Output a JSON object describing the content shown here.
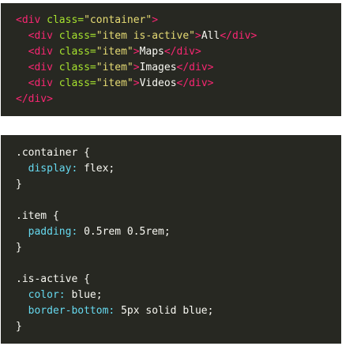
{
  "html_code": {
    "lines": [
      [
        {
          "t": "<div ",
          "c": "tag"
        },
        {
          "t": "class=",
          "c": "attr"
        },
        {
          "t": "\"container\"",
          "c": "str"
        },
        {
          "t": ">",
          "c": "tag"
        }
      ],
      [
        {
          "t": "  <div ",
          "c": "tag"
        },
        {
          "t": "class=",
          "c": "attr"
        },
        {
          "t": "\"item is-active\"",
          "c": "str"
        },
        {
          "t": ">",
          "c": "tag"
        },
        {
          "t": "All",
          "c": "text"
        },
        {
          "t": "</div>",
          "c": "tag"
        }
      ],
      [
        {
          "t": "  <div ",
          "c": "tag"
        },
        {
          "t": "class=",
          "c": "attr"
        },
        {
          "t": "\"item\"",
          "c": "str"
        },
        {
          "t": ">",
          "c": "tag"
        },
        {
          "t": "Maps",
          "c": "text"
        },
        {
          "t": "</div>",
          "c": "tag"
        }
      ],
      [
        {
          "t": "  <div ",
          "c": "tag"
        },
        {
          "t": "class=",
          "c": "attr"
        },
        {
          "t": "\"item\"",
          "c": "str"
        },
        {
          "t": ">",
          "c": "tag"
        },
        {
          "t": "Images",
          "c": "text"
        },
        {
          "t": "</div>",
          "c": "tag"
        }
      ],
      [
        {
          "t": "  <div ",
          "c": "tag"
        },
        {
          "t": "class=",
          "c": "attr"
        },
        {
          "t": "\"item\"",
          "c": "str"
        },
        {
          "t": ">",
          "c": "tag"
        },
        {
          "t": "Videos",
          "c": "text"
        },
        {
          "t": "</div>",
          "c": "tag"
        }
      ],
      [
        {
          "t": "</div>",
          "c": "tag"
        }
      ]
    ]
  },
  "css_code": {
    "lines": [
      [
        {
          "t": ".container {",
          "c": "sel"
        }
      ],
      [
        {
          "t": "  display: ",
          "c": "prop"
        },
        {
          "t": "flex;",
          "c": "text"
        }
      ],
      [
        {
          "t": "}",
          "c": "sel"
        }
      ],
      [],
      [
        {
          "t": ".item {",
          "c": "sel"
        }
      ],
      [
        {
          "t": "  padding: ",
          "c": "prop"
        },
        {
          "t": "0.5rem 0.5rem;",
          "c": "text"
        }
      ],
      [
        {
          "t": "}",
          "c": "sel"
        }
      ],
      [],
      [
        {
          "t": ".is-active {",
          "c": "sel"
        }
      ],
      [
        {
          "t": "  color: ",
          "c": "prop"
        },
        {
          "t": "blue;",
          "c": "text"
        }
      ],
      [
        {
          "t": "  border-bottom: ",
          "c": "prop"
        },
        {
          "t": "5px solid blue;",
          "c": "text"
        }
      ],
      [
        {
          "t": "}",
          "c": "sel"
        }
      ]
    ]
  },
  "colors": {
    "background": "#272822",
    "tag": "#f92672",
    "attr": "#a6e22e",
    "string": "#e6db74",
    "text": "#f8f8f2",
    "property": "#66d9ef"
  }
}
